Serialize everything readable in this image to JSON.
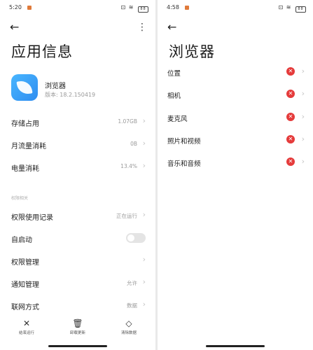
{
  "left": {
    "status": {
      "time": "5:20",
      "battery": "88"
    },
    "title": "应用信息",
    "app": {
      "name": "浏览器",
      "version": "版本: 18.2.150419"
    },
    "rows": [
      {
        "label": "存储占用",
        "value": "1.07GB"
      },
      {
        "label": "月流量消耗",
        "value": "0B"
      },
      {
        "label": "电量消耗",
        "value": "13.4%"
      }
    ],
    "section_label": "权限相关",
    "rows2": [
      {
        "label": "权限使用记录",
        "value": "正在运行"
      },
      {
        "label": "自启动",
        "value": ""
      },
      {
        "label": "权限管理",
        "value": ""
      },
      {
        "label": "通知管理",
        "value": "允许"
      },
      {
        "label": "联网方式",
        "value": "数据"
      }
    ],
    "bottom": [
      {
        "label": "结束运行",
        "icon": "close-icon"
      },
      {
        "label": "卸载更新",
        "icon": "trash-icon"
      },
      {
        "label": "清除数据",
        "icon": "eraser-icon"
      }
    ]
  },
  "right": {
    "status": {
      "time": "4:58",
      "battery": "88"
    },
    "title": "浏览器",
    "permissions": [
      {
        "label": "位置"
      },
      {
        "label": "相机"
      },
      {
        "label": "麦克风"
      },
      {
        "label": "照片和视频"
      },
      {
        "label": "音乐和音频"
      }
    ]
  }
}
